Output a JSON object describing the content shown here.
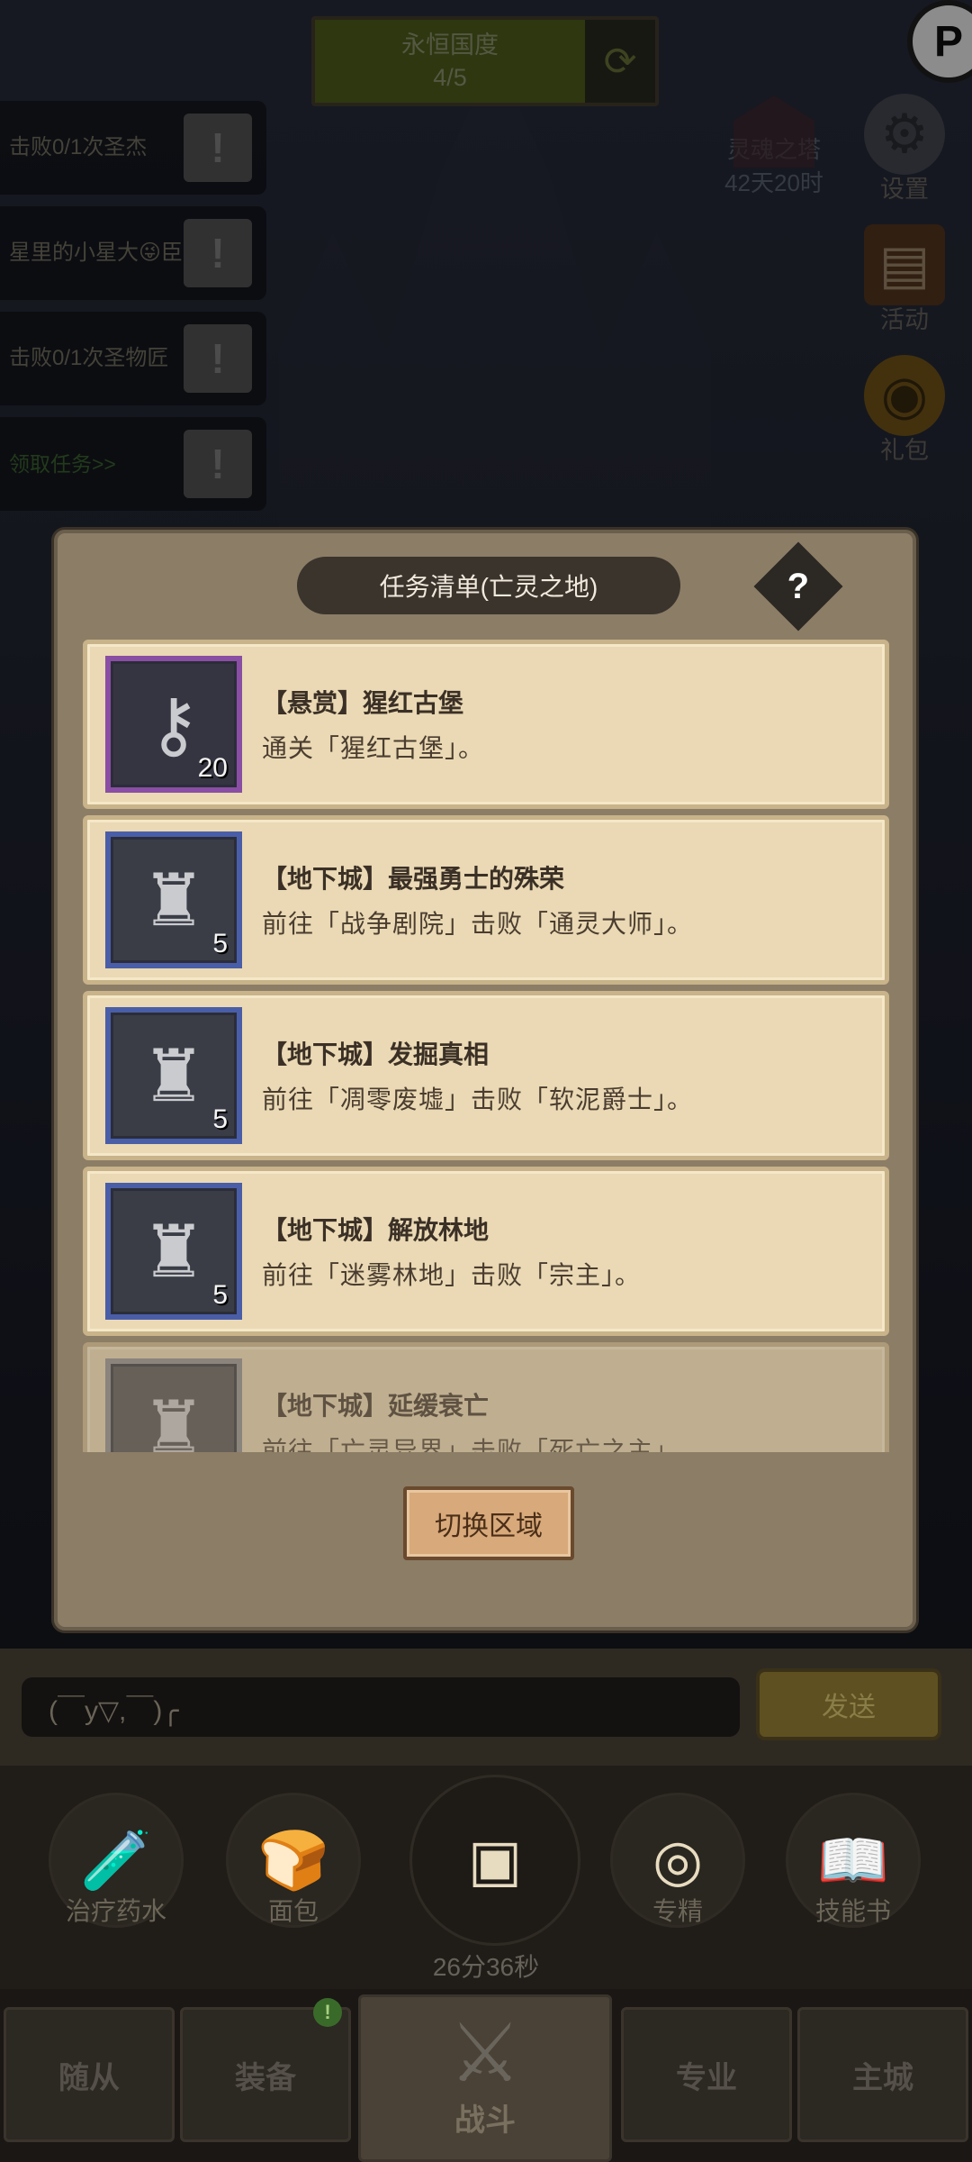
{
  "top_bar": {
    "title": "永恒国度",
    "progress": "4/5"
  },
  "side_quests": [
    {
      "text": "击败0/1次圣杰",
      "icon": "exclamation-icon"
    },
    {
      "text": "星里的小星大😜臣",
      "icon": "exclamation-icon"
    },
    {
      "text": "击败0/1次圣物匠",
      "icon": "exclamation-icon"
    },
    {
      "text": "领取任务>>",
      "icon": "exclamation-icon"
    }
  ],
  "tower": {
    "name": "灵魂之塔",
    "timer": "42天20时"
  },
  "side_menu": {
    "settings": "设置",
    "events": "活动",
    "gift": "礼包"
  },
  "modal": {
    "title": "任务清单(亡灵之地)",
    "help": "?",
    "tasks": [
      {
        "title": "【悬赏】猩红古堡",
        "desc": "通关「猩红古堡」。",
        "count": "20",
        "icon": "key-icon",
        "frame": "purple"
      },
      {
        "title": "【地下城】最强勇士的殊荣",
        "desc": "前往「战争剧院」击败「通灵大师」。",
        "count": "5",
        "icon": "horned-helmet-icon",
        "frame": "blue"
      },
      {
        "title": "【地下城】发掘真相",
        "desc": "前往「凋零废墟」击败「软泥爵士」。",
        "count": "5",
        "icon": "horned-helmet-icon",
        "frame": "blue"
      },
      {
        "title": "【地下城】解放林地",
        "desc": "前往「迷雾林地」击败「宗主」。",
        "count": "5",
        "icon": "horned-helmet-icon",
        "frame": "blue"
      },
      {
        "title": "【地下城】延缓衰亡",
        "desc": "前往「亡灵异界」击败「死亡之主」。",
        "count": "",
        "icon": "horned-helmet-icon",
        "frame": "grey"
      }
    ],
    "switch_button": "切换区域"
  },
  "chat": {
    "input_text": "(￣y▽,￣)╭",
    "send": "发送"
  },
  "items": {
    "potion": "治疗药水",
    "bread": "面包",
    "chest_timer": "26分36秒",
    "specialize": "专精",
    "skill_book": "技能书"
  },
  "nav": {
    "followers": "随从",
    "equipment": "装备",
    "battle": "战斗",
    "profession": "专业",
    "main_city": "主城",
    "equipment_badge": "!"
  }
}
